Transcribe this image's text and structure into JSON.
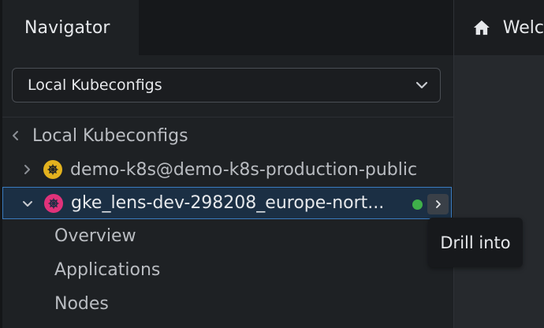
{
  "navigator": {
    "tab_label": "Navigator",
    "catalog_select": {
      "selected": "Local Kubeconfigs"
    },
    "tree": {
      "root_label": "Local Kubeconfigs",
      "clusters": [
        {
          "label": "demo-k8s@demo-k8s-production-public",
          "icon": "kubernetes-icon",
          "icon_color": "#e3b21e",
          "expanded": false
        },
        {
          "label": "gke_lens-dev-298208_europe-nort...",
          "icon": "kubernetes-icon",
          "icon_color": "#e0327a",
          "expanded": true,
          "selected": true,
          "status": "connected",
          "status_color": "#3fb04a"
        }
      ],
      "sub_items": [
        "Overview",
        "Applications",
        "Nodes"
      ]
    }
  },
  "tooltip": {
    "text": "Drill into"
  },
  "main": {
    "tab_label": "Welc",
    "icon": "home-icon"
  },
  "colors": {
    "accent": "#3a7bbf",
    "selected_bg": "#1b2f44"
  }
}
